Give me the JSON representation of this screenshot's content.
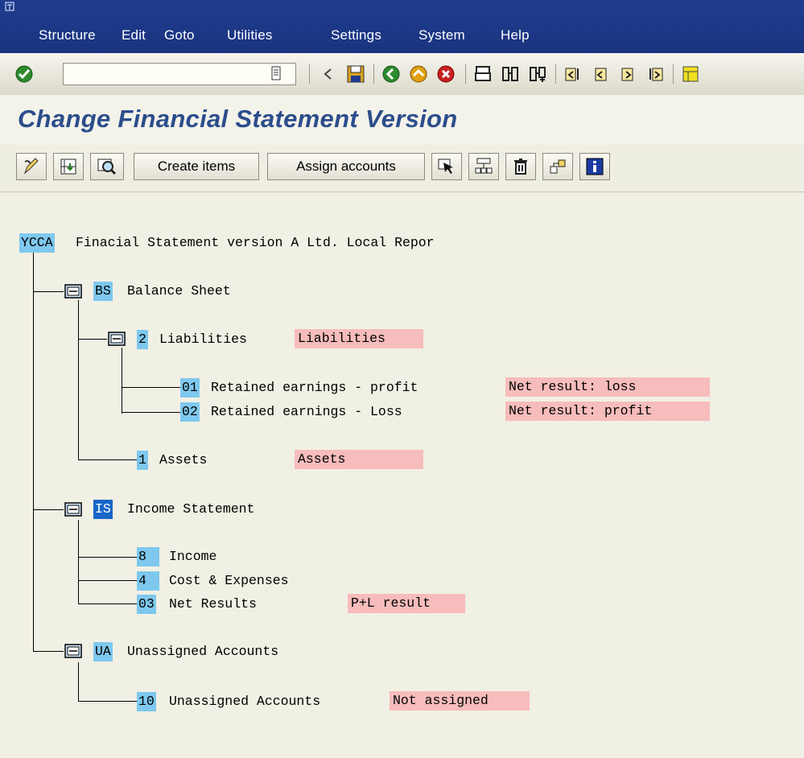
{
  "menu": {
    "items": [
      "Structure",
      "Edit",
      "Goto",
      "Utilities",
      "Settings",
      "System",
      "Help"
    ]
  },
  "toolbar": {
    "command_value": "",
    "icons": [
      "enter-icon",
      "back-arrow-icon",
      "save-icon",
      "back-icon",
      "exit-icon",
      "cancel-icon",
      "print-icon",
      "find-icon",
      "find-next-icon",
      "first-page-icon",
      "previous-page-icon",
      "next-page-icon",
      "last-page-icon",
      "layout-icon"
    ]
  },
  "page": {
    "title": "Change Financial Statement Version"
  },
  "app_toolbar": {
    "create_items": "Create items",
    "assign_accounts": "Assign accounts"
  },
  "tree": {
    "root": {
      "key": "YCCA",
      "text": "Finacial Statement version A Ltd. Local Repor"
    },
    "bs": {
      "key": "BS",
      "text": "Balance Sheet"
    },
    "liab": {
      "key": "2",
      "text": "Liabilities",
      "tag": "Liabilities"
    },
    "re_profit": {
      "key": "01",
      "text": "Retained earnings - profit",
      "tag": "Net result: loss"
    },
    "re_loss": {
      "key": "02",
      "text": "Retained earnings - Loss",
      "tag": "Net result: profit"
    },
    "assets": {
      "key": "1",
      "text": "Assets",
      "tag": "Assets"
    },
    "is": {
      "key": "IS",
      "text": "Income Statement"
    },
    "income": {
      "key": "8",
      "text": "Income"
    },
    "cost": {
      "key": "4",
      "text": "Cost & Expenses"
    },
    "net": {
      "key": "03",
      "text": "Net Results",
      "tag": "P+L result"
    },
    "ua": {
      "key": "UA",
      "text": "Unassigned Accounts"
    },
    "unassigned": {
      "key": "10",
      "text": "Unassigned Accounts",
      "tag": "Not assigned"
    }
  },
  "colors": {
    "menubar": "#1f3c8e",
    "title": "#2c4d8c",
    "key_highlight": "#7ec8ee",
    "key_selected": "#1866c8",
    "text_tag": "#f7bcbc",
    "background": "#f1f0e4"
  }
}
